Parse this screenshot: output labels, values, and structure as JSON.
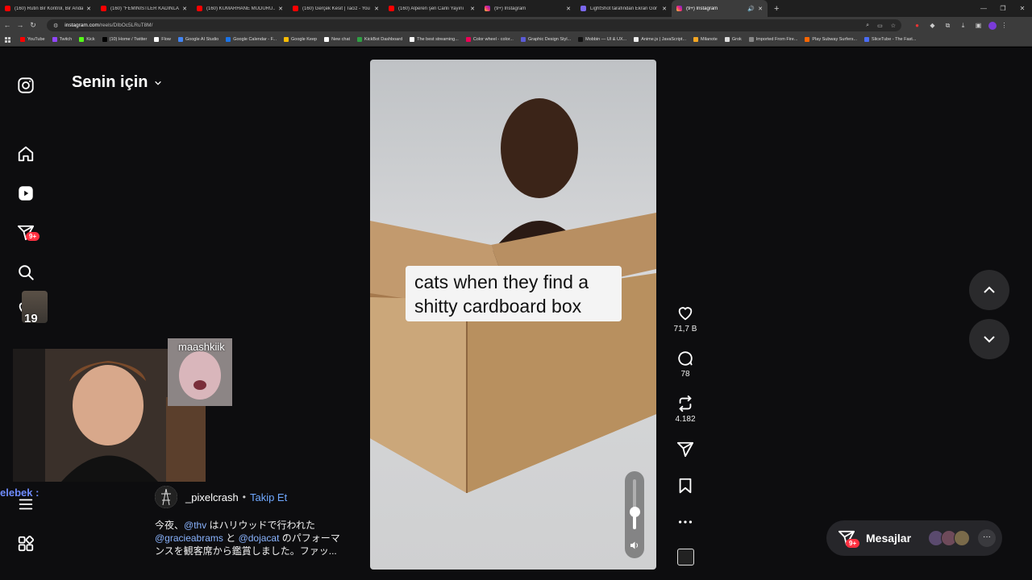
{
  "browser": {
    "tabs": [
      {
        "title": "(160) Rutin Bir Kontrol, Bir Anda",
        "type": "yt"
      },
      {
        "title": "(160) \"FEMİNİSTLER KADINLARI",
        "type": "yt"
      },
      {
        "title": "(160) KUMARHANE MÜDÜRÜ...",
        "type": "yt"
      },
      {
        "title": "(160) Gerçek Kesit | Taciz - You",
        "type": "yt"
      },
      {
        "title": "(160) Alperen şen Canlı Yayını",
        "type": "yt"
      },
      {
        "title": "(9+) Instagram",
        "type": "ig"
      },
      {
        "title": "LightShot tarafından Ekran Gör",
        "type": "ls"
      },
      {
        "title": "(9+) Instagram",
        "type": "ig",
        "active": true
      }
    ],
    "url_host": "instagram.com",
    "url_path": "/reels/DIbOc5LRuT8M/",
    "bookmarks": [
      "YouTube",
      "Twitch",
      "Kick",
      "(10) Home / Twitter",
      "Flow",
      "Google AI Studio",
      "Google Calendar - F...",
      "Google Keep",
      "New chat",
      "KickBot Dashboard",
      "The best streaming...",
      "Color wheel - color...",
      "Graphic Design Styl...",
      "Mobbin — UI & UX...",
      "Anime.js | JavaScript...",
      "Milanote",
      "Grok",
      "Imported From Fire...",
      "Play Subway Surfers...",
      "SliceTube - The Fast..."
    ]
  },
  "sidebar": {
    "notifications_badge": "9+",
    "profile_badge": "19"
  },
  "feed": {
    "title": "Senin için"
  },
  "reel": {
    "caption": "cats when they find a shitty cardboard box",
    "volume_level": 0.35
  },
  "actions": {
    "likes": "71,7 B",
    "comments": "78",
    "reposts": "4.182"
  },
  "stream": {
    "mini_label": "maashkiik",
    "chat_fragment": "elebek :"
  },
  "post": {
    "author": "_pixelcrash",
    "separator": "•",
    "follow": "Takip Et",
    "desc_1": "今夜、",
    "mention_1": "@thv",
    "desc_2": " はハリウッドで行われた",
    "mention_2": "@gracieabrams",
    "desc_3": " と ",
    "mention_3": "@dojacat",
    "desc_4": " のパフォーマンスを観客席から鑑賞しました。ファッ..."
  },
  "messages": {
    "label": "Mesajlar",
    "badge": "9+"
  },
  "colors": {
    "accent_blue": "#6fa8ff",
    "badge_red": "#ff3040"
  }
}
